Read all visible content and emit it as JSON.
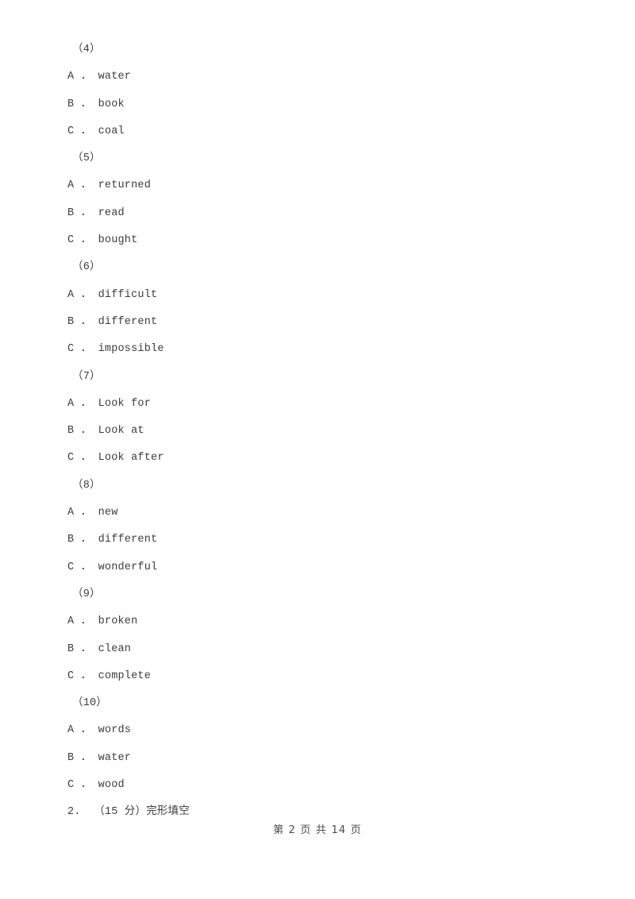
{
  "document": {
    "page_background": "#ffffff",
    "text_color": "#3d3d3d",
    "blocks": [
      {
        "kind": "stem",
        "text": "（4）"
      },
      {
        "kind": "option",
        "text": "A ． water"
      },
      {
        "kind": "option",
        "text": "B ． book"
      },
      {
        "kind": "option",
        "text": "C ． coal"
      },
      {
        "kind": "stem",
        "text": "（5）"
      },
      {
        "kind": "option",
        "text": "A ． returned"
      },
      {
        "kind": "option",
        "text": "B ． read"
      },
      {
        "kind": "option",
        "text": "C ． bought"
      },
      {
        "kind": "stem",
        "text": "（6）"
      },
      {
        "kind": "option",
        "text": "A ． difficult"
      },
      {
        "kind": "option",
        "text": "B ． different"
      },
      {
        "kind": "option",
        "text": "C ． impossible"
      },
      {
        "kind": "stem",
        "text": "（7）"
      },
      {
        "kind": "option",
        "text": "A ． Look for"
      },
      {
        "kind": "option",
        "text": "B ． Look at"
      },
      {
        "kind": "option",
        "text": "C ． Look after"
      },
      {
        "kind": "stem",
        "text": "（8）"
      },
      {
        "kind": "option",
        "text": "A ． new"
      },
      {
        "kind": "option",
        "text": "B ． different"
      },
      {
        "kind": "option",
        "text": "C ． wonderful"
      },
      {
        "kind": "stem",
        "text": "（9）"
      },
      {
        "kind": "option",
        "text": "A ． broken"
      },
      {
        "kind": "option",
        "text": "B ． clean"
      },
      {
        "kind": "option",
        "text": "C ． complete"
      },
      {
        "kind": "stem",
        "text": "（10）"
      },
      {
        "kind": "option",
        "text": "A ． words"
      },
      {
        "kind": "option",
        "text": "B ． water"
      },
      {
        "kind": "option",
        "text": "C ． wood"
      },
      {
        "kind": "section-head",
        "text": "2.  （15 分）完形填空"
      }
    ]
  },
  "footer": {
    "text": "第 2 页 共 14 页",
    "current_page": "2",
    "total_pages": "14"
  }
}
